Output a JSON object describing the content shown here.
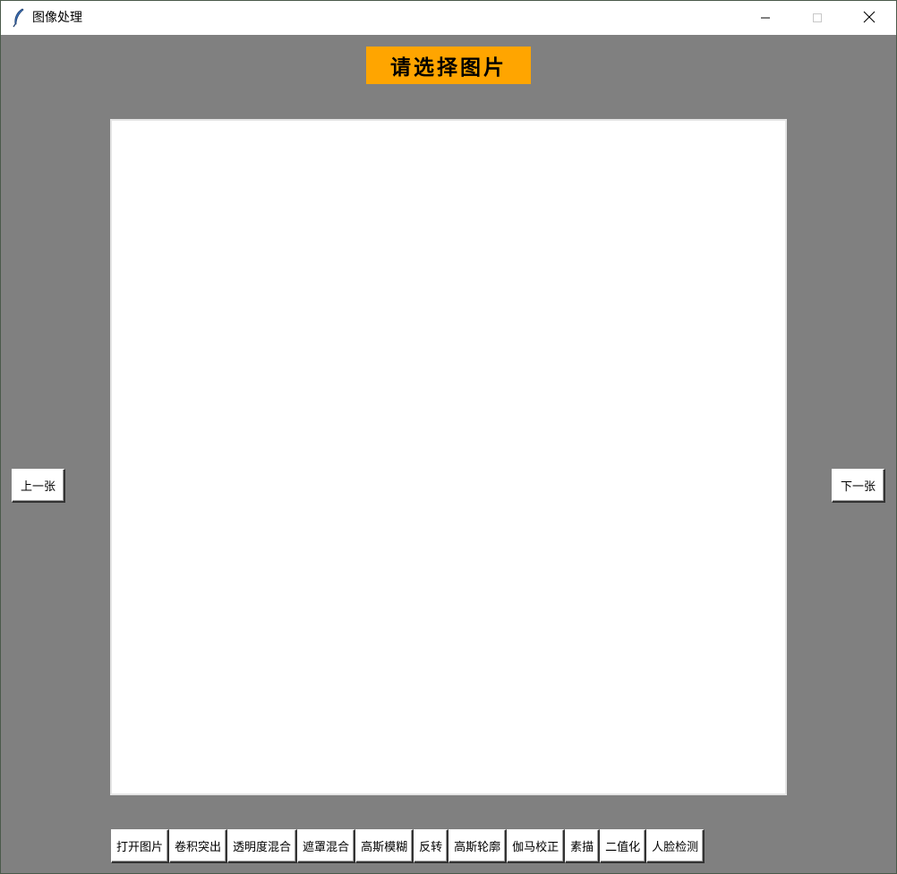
{
  "window": {
    "title": "图像处理",
    "background_color": "#808080"
  },
  "titlebar": {
    "app_icon": "feather-icon",
    "minimize_icon": "minimize-icon",
    "maximize_icon": "maximize-icon",
    "close_icon": "close-icon"
  },
  "heading": {
    "text": "请选择图片",
    "background_color": "#ffa500"
  },
  "navigation": {
    "prev_label": "上一张",
    "next_label": "下一张"
  },
  "toolbar": {
    "buttons": [
      {
        "label": "打开图片"
      },
      {
        "label": "卷积突出"
      },
      {
        "label": "透明度混合"
      },
      {
        "label": "遮罩混合"
      },
      {
        "label": "高斯模糊"
      },
      {
        "label": "反转"
      },
      {
        "label": "高斯轮廓"
      },
      {
        "label": "伽马校正"
      },
      {
        "label": "素描"
      },
      {
        "label": "二值化"
      },
      {
        "label": "人脸检测"
      }
    ]
  }
}
